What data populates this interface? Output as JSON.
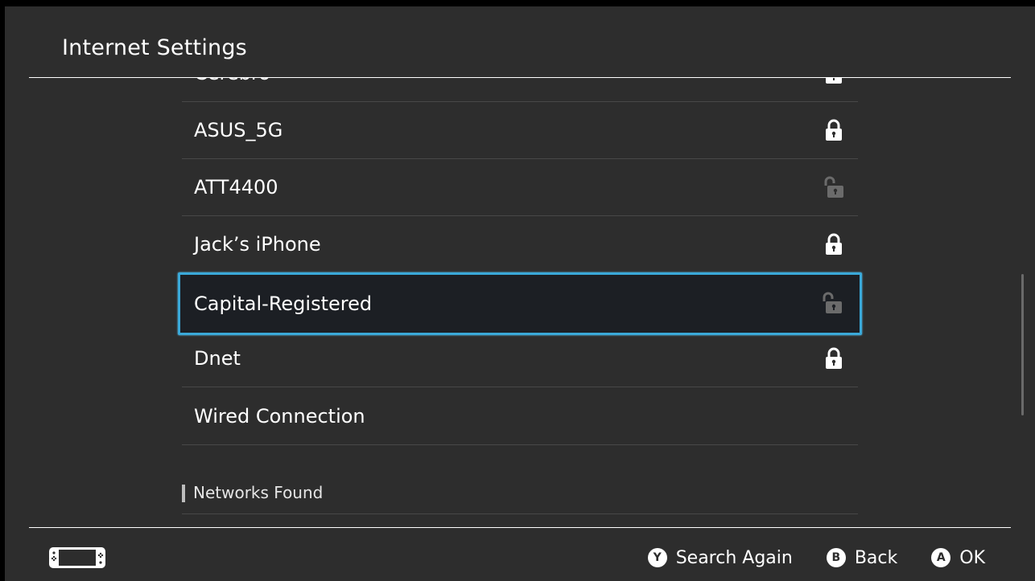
{
  "window": {
    "title": "Internet Settings"
  },
  "networks": [
    {
      "name": "Cerebro",
      "lock": "locked"
    },
    {
      "name": "ASUS_5G",
      "lock": "locked"
    },
    {
      "name": "ATT4400",
      "lock": "unlocked"
    },
    {
      "name": "Jack’s iPhone",
      "lock": "locked"
    },
    {
      "name": "Capital-Registered",
      "lock": "unlocked",
      "selected": true
    },
    {
      "name": "Dnet",
      "lock": "locked"
    },
    {
      "name": "Wired Connection",
      "lock": "none"
    }
  ],
  "section": {
    "label": "Networks Found"
  },
  "footer": {
    "buttons": [
      {
        "key": "Y",
        "label": "Search Again"
      },
      {
        "key": "B",
        "label": "Back"
      },
      {
        "key": "A",
        "label": "OK"
      }
    ]
  },
  "colors": {
    "background": "#2d2d2d",
    "selection_border": "#3aa9d9",
    "selection_fill": "#1c1f24",
    "lock_active": "#ffffff",
    "lock_inactive": "#6b6b6b"
  }
}
